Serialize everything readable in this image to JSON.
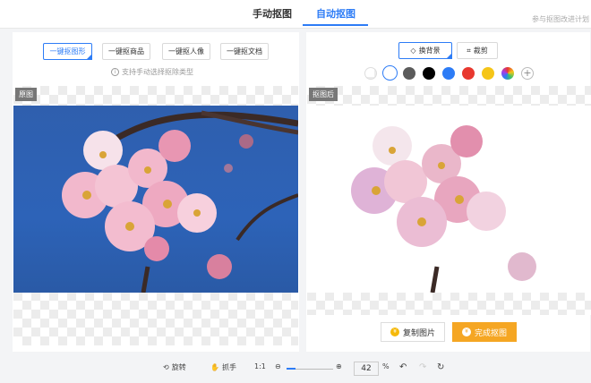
{
  "tabs": [
    {
      "label": "手动抠图"
    },
    {
      "label": "自动抠图"
    }
  ],
  "progress_note": "参与抠图改进计划",
  "left": {
    "modes": [
      "一键抠图形",
      "一键抠商品",
      "一键抠人像",
      "一键抠文档"
    ],
    "hint": "支持手动选择抠除类型",
    "badge": "原图"
  },
  "right": {
    "change_bg_label": "换背景",
    "crop_label": "裁剪",
    "badge": "抠图后",
    "swatches": [
      "transparent",
      "#ffffff",
      "#5b5b5b",
      "#000000",
      "#2d7cf6",
      "#e8382f",
      "#f5c518",
      "rainbow"
    ],
    "add_symbol": "+",
    "copy_label": "复制图片",
    "done_label": "完成抠图"
  },
  "bottom": {
    "rotate_label": "旋转",
    "hand_label": "抓手",
    "ratio_label": "1:1",
    "zoom_value": "42",
    "zoom_unit": "%"
  },
  "colors": {
    "accent": "#2d7cf6",
    "orange": "#f5a623"
  }
}
